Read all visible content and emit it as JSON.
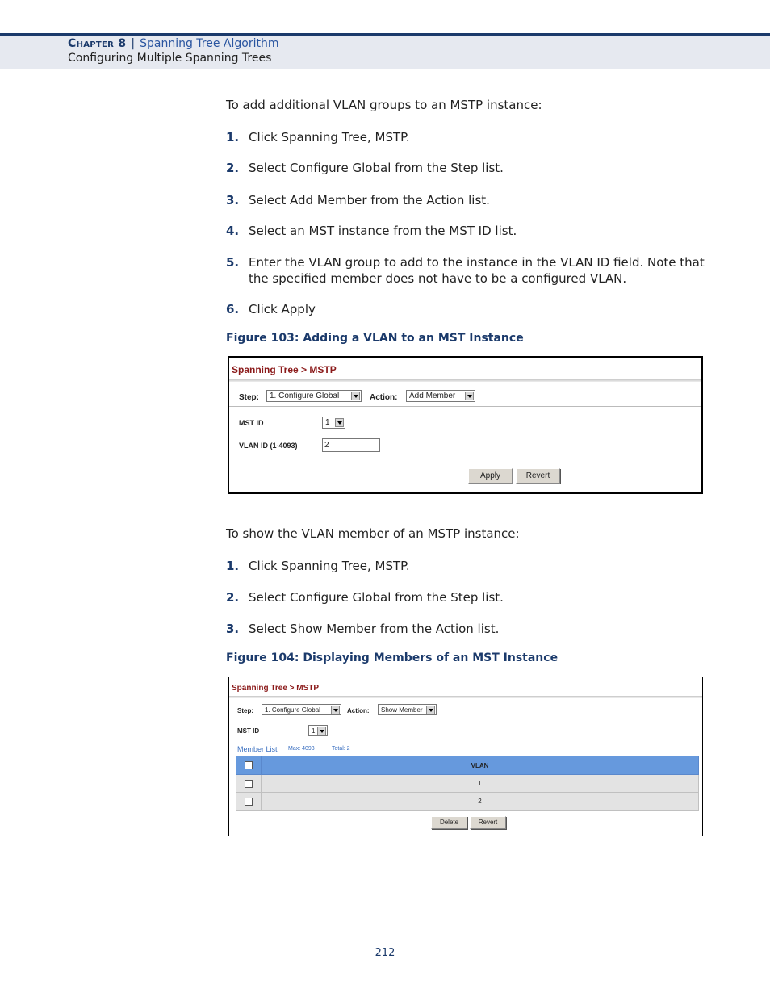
{
  "header": {
    "chapter": "Chapter 8",
    "separator": "|",
    "chapter_title": "Spanning Tree Algorithm",
    "section": "Configuring Multiple Spanning Trees"
  },
  "section1": {
    "intro": "To add additional VLAN groups to an MSTP instance:",
    "steps": [
      {
        "num": "1.",
        "text": "Click Spanning Tree, MSTP."
      },
      {
        "num": "2.",
        "text": "Select Configure Global from the Step list."
      },
      {
        "num": "3.",
        "text": "Select Add Member from the Action list."
      },
      {
        "num": "4.",
        "text": "Select an MST instance from the MST ID list."
      },
      {
        "num": "5.",
        "text": "Enter the VLAN group to add to the instance in the VLAN ID field. Note that the specified member does not have to be a configured VLAN."
      },
      {
        "num": "6.",
        "text": "Click Apply"
      }
    ],
    "figure_caption": "Figure 103:  Adding a VLAN to an MST Instance"
  },
  "figure1": {
    "breadcrumb": "Spanning Tree > MSTP",
    "step_label": "Step:",
    "step_value": "1. Configure Global",
    "action_label": "Action:",
    "action_value": "Add Member",
    "mst_id_label": "MST ID",
    "mst_id_value": "1",
    "vlan_id_label": "VLAN ID (1-4093)",
    "vlan_id_value": "2",
    "apply_label": "Apply",
    "revert_label": "Revert"
  },
  "section2": {
    "intro": "To show the VLAN member of an MSTP instance:",
    "steps": [
      {
        "num": "1.",
        "text": "Click Spanning Tree, MSTP."
      },
      {
        "num": "2.",
        "text": "Select Configure Global from the Step list."
      },
      {
        "num": "3.",
        "text": "Select Show Member from the Action list."
      }
    ],
    "figure_caption": "Figure 104:  Displaying Members of an MST Instance"
  },
  "figure2": {
    "breadcrumb": "Spanning Tree > MSTP",
    "step_label": "Step:",
    "step_value": "1. Configure Global",
    "action_label": "Action:",
    "action_value": "Show Member",
    "mst_id_label": "MST ID",
    "mst_id_value": "1",
    "member_list_label": "Member List",
    "max_label": "Max: 4093",
    "total_label": "Total: 2",
    "table": {
      "column_header": "VLAN",
      "rows": [
        {
          "vlan": "1"
        },
        {
          "vlan": "2"
        }
      ]
    },
    "delete_label": "Delete",
    "revert_label": "Revert"
  },
  "footer": {
    "page_number": "–  212  –"
  }
}
